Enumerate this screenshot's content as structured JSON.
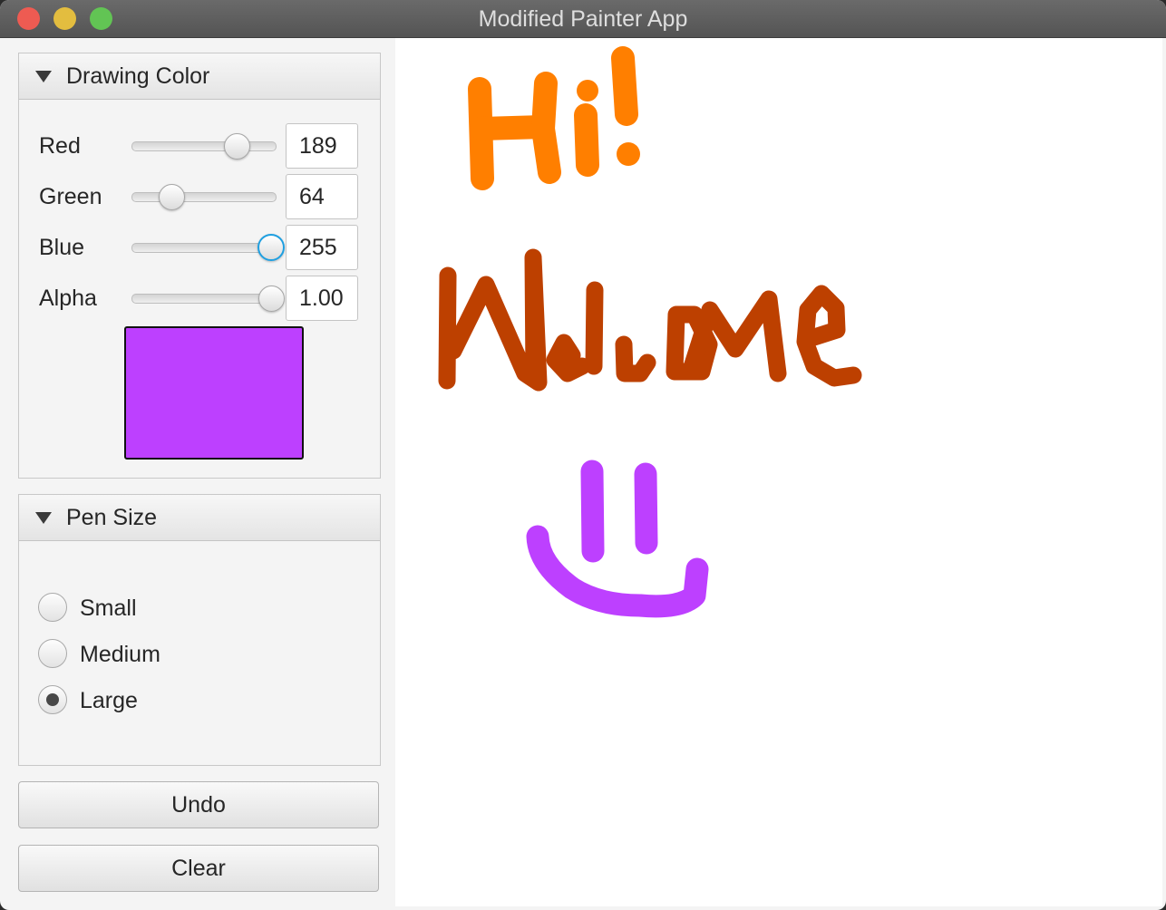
{
  "window": {
    "title": "Modified Painter App"
  },
  "drawing_color": {
    "header": "Drawing Color",
    "red": {
      "label": "Red",
      "value": "189",
      "fraction": 0.741
    },
    "green": {
      "label": "Green",
      "value": "64",
      "fraction": 0.251
    },
    "blue": {
      "label": "Blue",
      "value": "255",
      "fraction": 1.0
    },
    "alpha": {
      "label": "Alpha",
      "value": "1.00",
      "fraction": 1.0
    },
    "swatch_color": "#bd40ff"
  },
  "pen_size": {
    "header": "Pen Size",
    "options": [
      {
        "label": "Small",
        "selected": false
      },
      {
        "label": "Medium",
        "selected": false
      },
      {
        "label": "Large",
        "selected": true
      }
    ]
  },
  "buttons": {
    "undo": "Undo",
    "clear": "Clear"
  },
  "canvas": {
    "background": "#ffffff",
    "stroke_colors": {
      "hi": "#ff7f00",
      "welcome": "#bd4000",
      "smile": "#bd40ff"
    }
  }
}
